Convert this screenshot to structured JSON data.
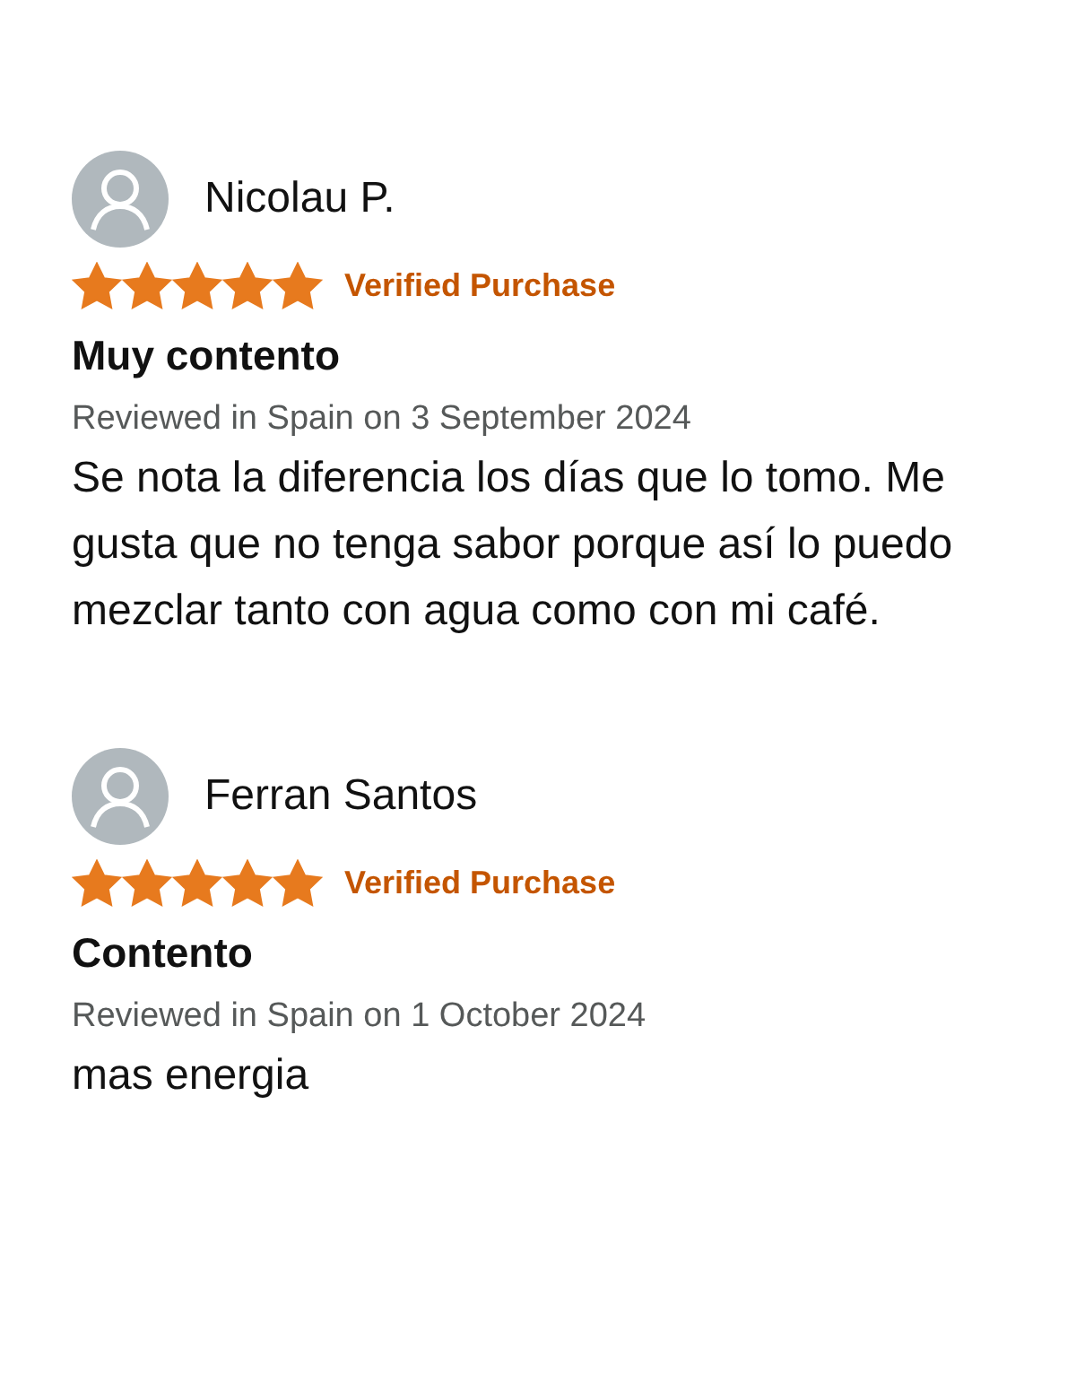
{
  "reviews": [
    {
      "author": "Nicolau P.",
      "stars": 5,
      "badge": "Verified Purchase",
      "title": "Muy contento",
      "meta": "Reviewed in Spain on 3 September 2024",
      "body": "Se nota la diferencia los días que lo tomo. Me gusta que no tenga sabor porque así lo puedo mezclar tanto con agua como con mi café."
    },
    {
      "author": "Ferran Santos",
      "stars": 5,
      "badge": "Verified Purchase",
      "title": "Contento",
      "meta": "Reviewed in Spain on 1 October 2024",
      "body": "mas energia"
    }
  ]
}
